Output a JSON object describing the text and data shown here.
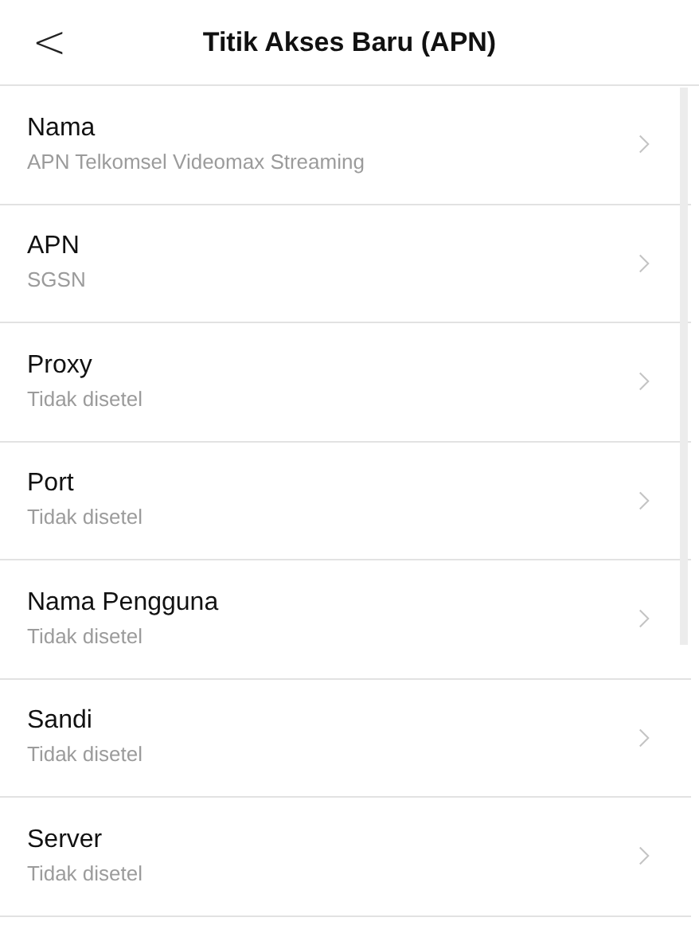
{
  "header": {
    "back": "<",
    "title": "Titik Akses Baru (APN)"
  },
  "settings": [
    {
      "label": "Nama",
      "value": "APN Telkomsel Videomax Streaming"
    },
    {
      "label": "APN",
      "value": "SGSN"
    },
    {
      "label": "Proxy",
      "value": "Tidak disetel"
    },
    {
      "label": "Port",
      "value": "Tidak disetel"
    },
    {
      "label": "Nama Pengguna",
      "value": "Tidak disetel"
    },
    {
      "label": "Sandi",
      "value": "Tidak disetel"
    },
    {
      "label": "Server",
      "value": "Tidak disetel"
    }
  ]
}
